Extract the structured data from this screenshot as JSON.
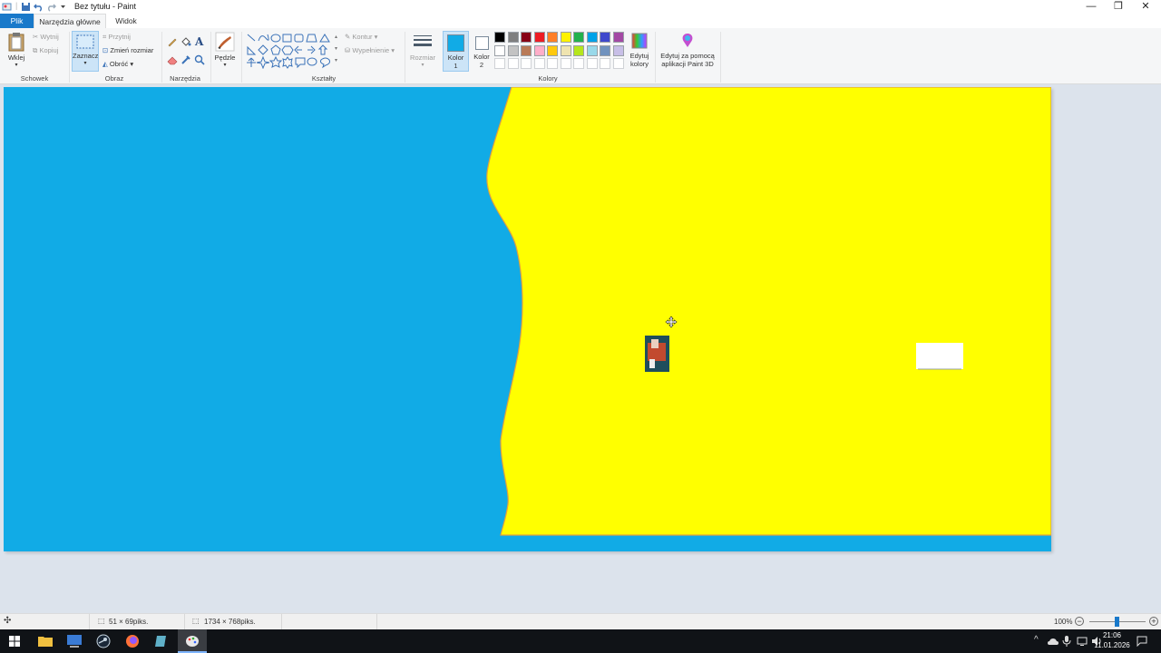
{
  "window": {
    "title": "Bez tytułu - Paint",
    "minimize": "—",
    "restore": "❐",
    "close": "✕"
  },
  "tabs": {
    "file": "Plik",
    "home": "Narzędzia główne",
    "view": "Widok"
  },
  "clipboard": {
    "paste": "Wklej",
    "cut": "Wytnij",
    "copy": "Kopiuj",
    "label": "Schowek"
  },
  "image": {
    "select": "Zaznacz",
    "crop": "Przytnij",
    "resize": "Zmień rozmiar",
    "rotate": "Obróć",
    "label": "Obraz"
  },
  "tools": {
    "label": "Narzędzia"
  },
  "brushes": {
    "label": "Pędzle"
  },
  "shapes": {
    "outline": "Kontur",
    "fill": "Wypełnienie",
    "label": "Kształty"
  },
  "size": {
    "label": "Rozmiar"
  },
  "colors": {
    "color1_line1": "Kolor",
    "color1_line2": "1",
    "color2_line1": "Kolor",
    "color2_line2": "2",
    "edit_line1": "Edytuj",
    "edit_line2": "kolory",
    "paint3d_line1": "Edytuj za pomocą",
    "paint3d_line2": "aplikacji Paint 3D",
    "label": "Kolory",
    "color1_value": "#11abe6",
    "color2_value": "#ffffff",
    "palette_row1": [
      "#000000",
      "#7f7f7f",
      "#880015",
      "#ed1c24",
      "#ff7f27",
      "#fff200",
      "#22b14c",
      "#00a2e8",
      "#3f48cc",
      "#a349a4"
    ],
    "palette_row2": [
      "#ffffff",
      "#c3c3c3",
      "#b97a57",
      "#ffaec9",
      "#ffc90e",
      "#efe4b0",
      "#b5e61d",
      "#99d9ea",
      "#7092be",
      "#c8bfe7"
    ]
  },
  "canvas": {
    "sky_color": "#11abe6",
    "yellow_color": "#ffff00"
  },
  "status": {
    "selection_size": "51 × 69piks.",
    "image_size": "1734 × 768piks.",
    "zoom": "100%"
  },
  "taskbar": {
    "time": "21:06",
    "date": "11.01.2026"
  }
}
